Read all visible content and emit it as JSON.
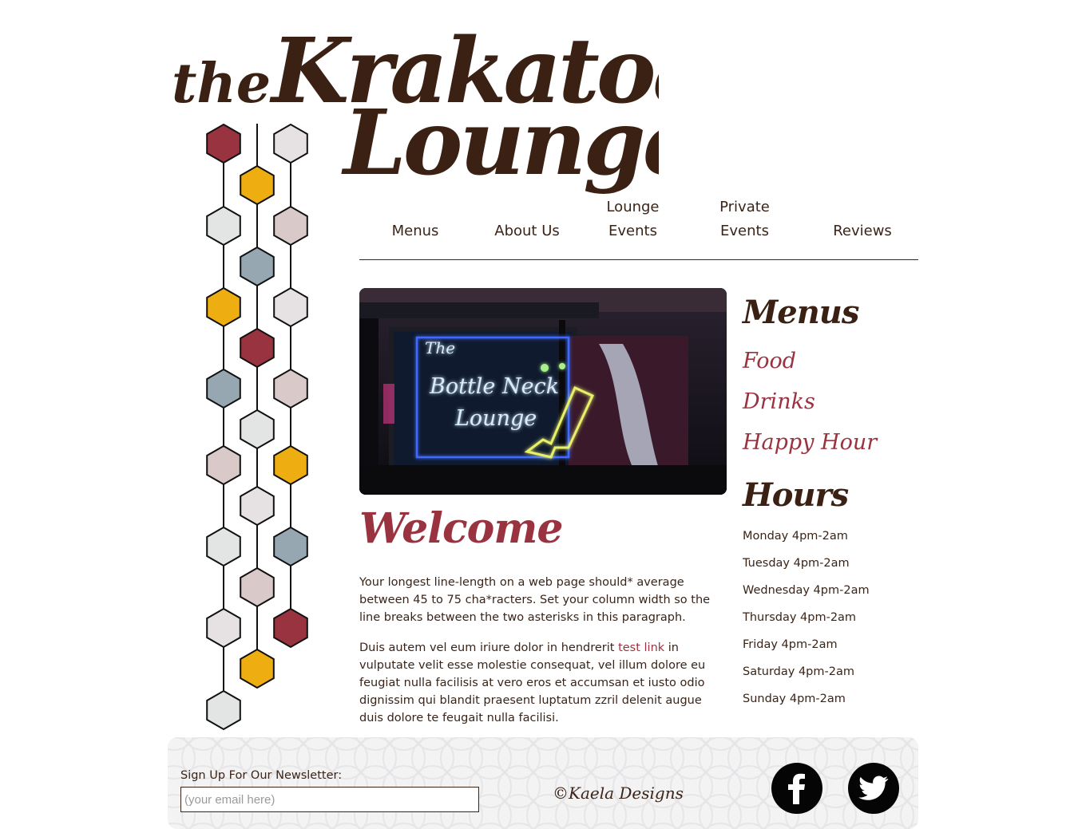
{
  "logo": {
    "line1": "the",
    "line2": "Krakatoa",
    "line3": "Lounge"
  },
  "nav": {
    "items": [
      {
        "label": "Menus"
      },
      {
        "label": "About Us"
      },
      {
        "label": "Lounge\nEvents"
      },
      {
        "label": "Private\nEvents"
      },
      {
        "label": "Reviews"
      }
    ]
  },
  "hero": {
    "sign_line1": "The",
    "sign_line2": "Bottle Neck",
    "sign_line3": "Lounge"
  },
  "welcome": {
    "title": "Welcome",
    "paragraph1": "Your longest line-length on a web page should* average between 45 to 75 cha*racters. Set your column width so the line breaks between the two asterisks in this paragraph.",
    "paragraph2_before": "Duis autem vel eum iriure dolor in hendrerit ",
    "paragraph2_link": "test link",
    "paragraph2_after": " in vulputate velit esse molestie consequat, vel illum dolore eu feugiat nulla facilisis at vero eros et accumsan et iusto odio dignissim qui blandit praesent luptatum zzril delenit augue duis dolore te feugait nulla facilisi."
  },
  "sidebar": {
    "menus_heading": "Menus",
    "menu_links": [
      "Food",
      "Drinks",
      "Happy Hour"
    ],
    "hours_heading": "Hours",
    "hours": [
      "Monday 4pm-2am",
      "Tuesday 4pm-2am",
      "Wednesday 4pm-2am",
      "Thursday 4pm-2am",
      "Friday 4pm-2am",
      "Saturday 4pm-2am",
      "Sunday 4pm-2am"
    ]
  },
  "footer": {
    "newsletter_label": "Sign Up For Our Newsletter:",
    "email_placeholder": "(your email here)",
    "credit": "©Kaela Designs",
    "social": [
      "facebook-icon",
      "twitter-icon"
    ]
  },
  "colors": {
    "brown": "#3b2114",
    "maroon": "#9a3340",
    "gold": "#eeae12",
    "steel": "#97a7b2",
    "blush": "#d9c9c9",
    "pale": "#e6e2e4",
    "mist": "#e2e5e4"
  }
}
